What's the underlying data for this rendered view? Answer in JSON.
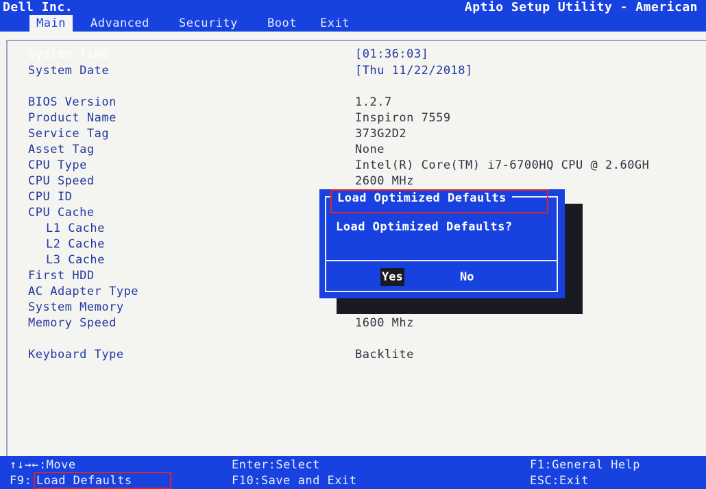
{
  "header": {
    "vendor": "Dell Inc.",
    "utility": "Aptio Setup Utility - American",
    "tabs": [
      "Main",
      "Advanced",
      "Security",
      "Boot",
      "Exit"
    ],
    "active_tab": "Main"
  },
  "main": {
    "items": [
      {
        "label": "System Time",
        "value": "[01:36:03]",
        "highlighted": true
      },
      {
        "label": "System Date",
        "value": "[Thu 11/22/2018]"
      },
      {
        "label": "BIOS Version",
        "value": "1.2.7"
      },
      {
        "label": "Product Name",
        "value": "Inspiron 7559"
      },
      {
        "label": "Service Tag",
        "value": "373G2D2"
      },
      {
        "label": "Asset Tag",
        "value": "None"
      },
      {
        "label": "CPU Type",
        "value": "Intel(R) Core(TM) i7-6700HQ CPU @ 2.60GH"
      },
      {
        "label": "CPU Speed",
        "value": "2600 MHz"
      },
      {
        "label": "CPU ID",
        "value": ""
      },
      {
        "label": "CPU Cache",
        "value": ""
      },
      {
        "label": "L1 Cache",
        "value": ""
      },
      {
        "label": "L2 Cache",
        "value": ""
      },
      {
        "label": "L3 Cache",
        "value": ""
      },
      {
        "label": "First HDD",
        "value": ""
      },
      {
        "label": "AC Adapter Type",
        "value": ""
      },
      {
        "label": "System Memory",
        "value": ""
      },
      {
        "label": "Memory Speed",
        "value": "1600 Mhz"
      },
      {
        "label": "Keyboard Type",
        "value": "Backlite"
      }
    ]
  },
  "dialog": {
    "title": "Load Optimized Defaults",
    "message": "Load Optimized Defaults?",
    "yes_label": "Yes",
    "no_label": "No",
    "selected": "Yes"
  },
  "footer": {
    "move": "↑↓→←:Move",
    "select": "Enter:Select",
    "help": "F1:General Help",
    "f9_key": "F9:",
    "f9_action": "Load Defaults",
    "save": "F10:Save and Exit",
    "exit": "ESC:Exit"
  },
  "colors": {
    "accent_blue": "#1842e0",
    "label_blue": "#2237a0",
    "highlight_red": "#e0232b",
    "background": "#f4f5f1"
  }
}
